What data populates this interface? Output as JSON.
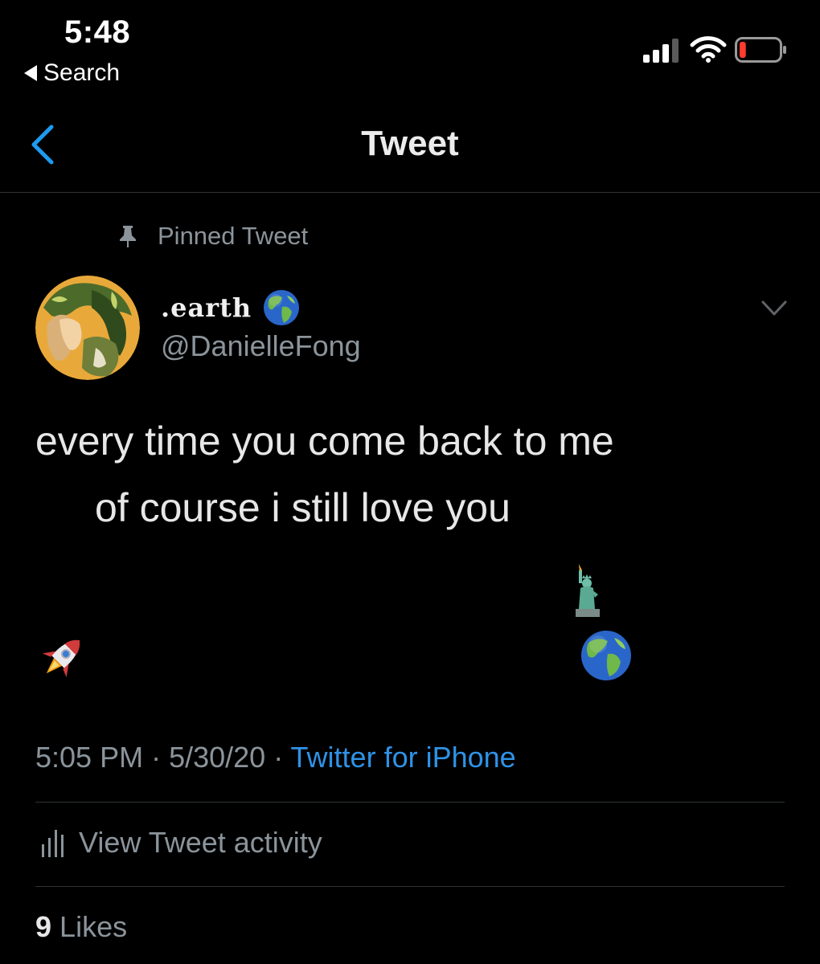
{
  "status_bar": {
    "time": "5:48",
    "back_app": "Search",
    "icons": [
      "cellular-signal-icon",
      "wifi-icon",
      "battery-icon"
    ],
    "battery_level": 0.1,
    "battery_color": "#ff3b30"
  },
  "nav": {
    "title": "Tweet",
    "back_icon": "chevron-left-icon",
    "accent_color": "#1d9bf0"
  },
  "tweet": {
    "pinned_label": "Pinned Tweet",
    "author": {
      "display_name": ".earth",
      "handle": "@DanielleFong"
    },
    "text_lines": [
      "every time you come back to me",
      "of course i still love you"
    ],
    "emojis": [
      "statue-of-liberty-emoji",
      "rocket-emoji",
      "earth-globe-emoji"
    ],
    "time": "5:05 PM",
    "separator": " · ",
    "date": "5/30/20",
    "source": "Twitter for iPhone",
    "activity_label": "View Tweet activity",
    "likes_count": "9",
    "likes_label": "Likes"
  }
}
